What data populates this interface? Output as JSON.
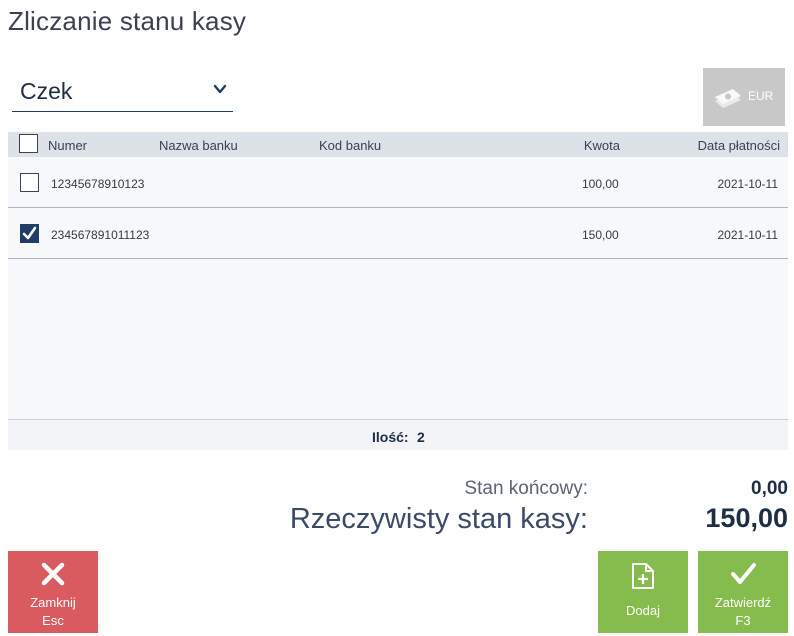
{
  "title": "Zliczanie stanu kasy",
  "payment_type": {
    "selected": "Czek",
    "icon": "chevron-down-icon"
  },
  "currency_button": {
    "label": "EUR",
    "icon": "cash-icon"
  },
  "grid": {
    "columns": [
      "Numer",
      "Nazwa banku",
      "Kod banku",
      "Kwota",
      "Data płatności"
    ],
    "rows": [
      {
        "checked": false,
        "numer": "12345678910123",
        "nazwa_banku": "",
        "kod_banku": "",
        "kwota": "100,00",
        "data": "2021-10-11"
      },
      {
        "checked": true,
        "numer": "234567891011123",
        "nazwa_banku": "",
        "kod_banku": "",
        "kwota": "150,00",
        "data": "2021-10-11"
      }
    ],
    "footer": {
      "label": "Ilość:",
      "value": "2"
    }
  },
  "summary": {
    "stan_koncowy_label": "Stan końcowy:",
    "stan_koncowy_value": "0,00",
    "rzeczywisty_label": "Rzeczywisty stan kasy:",
    "rzeczywisty_value": "150,00"
  },
  "buttons": {
    "close": {
      "label": "Zamknij",
      "shortcut": "Esc",
      "icon": "close-icon"
    },
    "add": {
      "label": "Dodaj",
      "icon": "add-document-icon"
    },
    "confirm": {
      "label": "Zatwierdź",
      "shortcut": "F3",
      "icon": "checkmark-icon"
    }
  },
  "colors": {
    "accent": "#1d3f66",
    "close": "#d95a5f",
    "success": "#86bb4e",
    "disabled": "#c8c8c8"
  }
}
